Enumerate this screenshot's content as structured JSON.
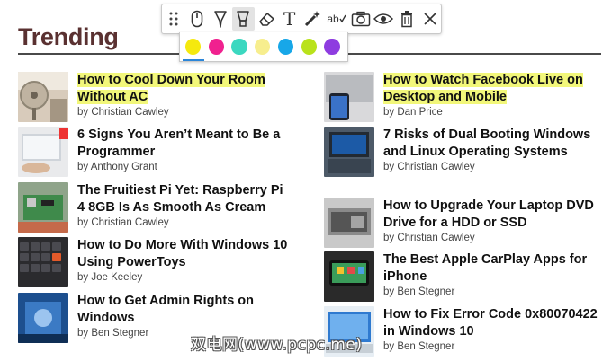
{
  "page": {
    "heading": "Trending"
  },
  "colors": {
    "heading": "#5a3131",
    "highlight": "#f2f77a",
    "palette_selected_underline": "#2b86d9"
  },
  "toolbar": {
    "tools": [
      {
        "name": "drag-handle-icon"
      },
      {
        "name": "mouse-pointer-icon"
      },
      {
        "name": "pen-icon"
      },
      {
        "name": "highlighter-icon",
        "active": true
      },
      {
        "name": "eraser-icon"
      },
      {
        "name": "text-tool-icon",
        "glyph": "T"
      },
      {
        "name": "magic-wand-icon"
      },
      {
        "name": "spell-check-icon",
        "glyph": "ab"
      },
      {
        "name": "camera-icon"
      },
      {
        "name": "eye-icon"
      },
      {
        "name": "trash-icon"
      },
      {
        "name": "close-icon"
      }
    ]
  },
  "palette": {
    "swatches": [
      "#f5e90e",
      "#f0218f",
      "#3bd8c0",
      "#f7ee8e",
      "#17a7e8",
      "#b9e21b",
      "#8e3ce0"
    ],
    "selected_index": 0
  },
  "articles": {
    "left": [
      {
        "title": "How to Cool Down Your Room Without AC",
        "author": "by Christian Cawley",
        "highlighted": true
      },
      {
        "title": "6 Signs You Aren’t Meant to Be a Programmer",
        "author": "by Anthony Grant"
      },
      {
        "title": "The Fruitiest Pi Yet: Raspberry Pi 4 8GB Is As Smooth As Cream",
        "author": "by Christian Cawley"
      },
      {
        "title": "How to Do More With Windows 10 Using PowerToys",
        "author": "by Joe Keeley"
      },
      {
        "title": "How to Get Admin Rights on Windows",
        "author": "by Ben Stegner"
      }
    ],
    "right": [
      {
        "title": "How to Watch Facebook Live on Desktop and Mobile",
        "author": "by Dan Price",
        "highlighted": true
      },
      {
        "title": "7 Risks of Dual Booting Windows and Linux Operating Systems",
        "author": "by Christian Cawley"
      },
      {
        "title": "How to Upgrade Your Laptop DVD Drive for a HDD or SSD",
        "author": "by Christian Cawley"
      },
      {
        "title": "The Best Apple CarPlay Apps for iPhone",
        "author": "by Ben Stegner"
      },
      {
        "title": "How to Fix Error Code 0x80070422 in Windows 10",
        "author": "by Ben Stegner"
      }
    ]
  },
  "watermark": "双电网(www.pcpc.me)"
}
